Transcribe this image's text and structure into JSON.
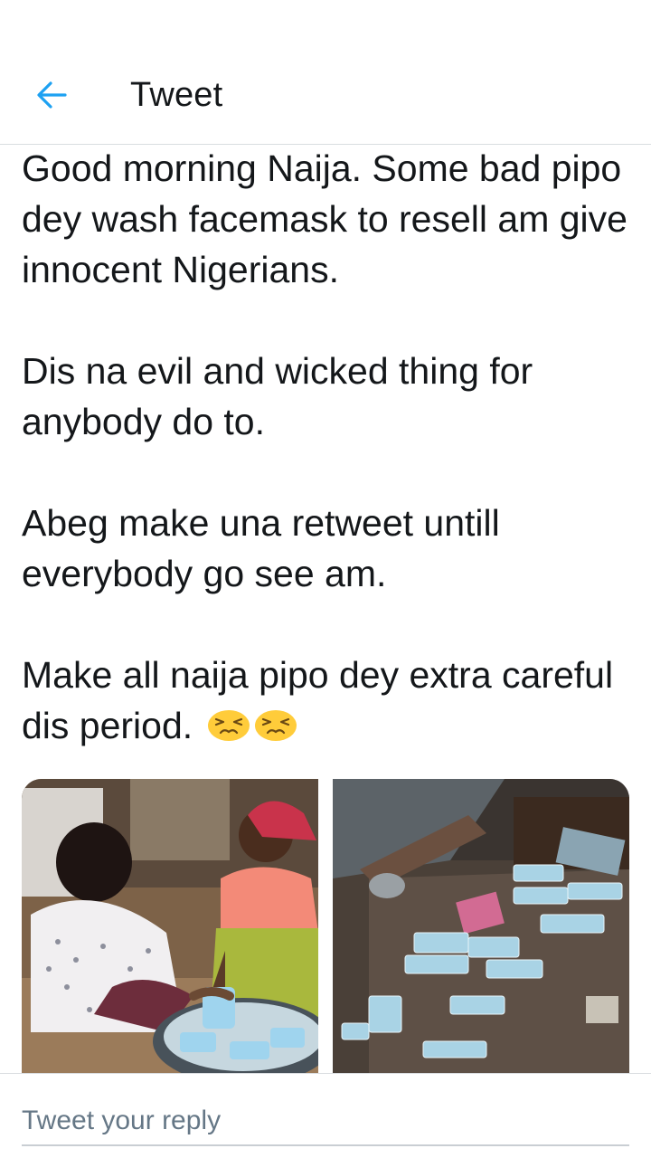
{
  "header": {
    "title": "Tweet",
    "back_icon": "arrow-left-icon",
    "accent_color": "#1da1f2"
  },
  "tweet": {
    "paragraphs": [
      "Good morning Naija.  Some bad pipo dey wash facemask to resell am give innocent Nigerians.",
      "Dis na evil and wicked thing for anybody do to.",
      "Abeg make una retweet untill everybody go see am.",
      "Make all naija pipo dey extra careful dis period."
    ],
    "emojis": [
      "persevering-face-icon",
      "persevering-face-icon"
    ],
    "media": [
      {
        "name": "women-washing-facemasks-photo"
      },
      {
        "name": "used-facemasks-on-floor-photo"
      }
    ]
  },
  "reply": {
    "placeholder": "Tweet your reply",
    "value": ""
  }
}
